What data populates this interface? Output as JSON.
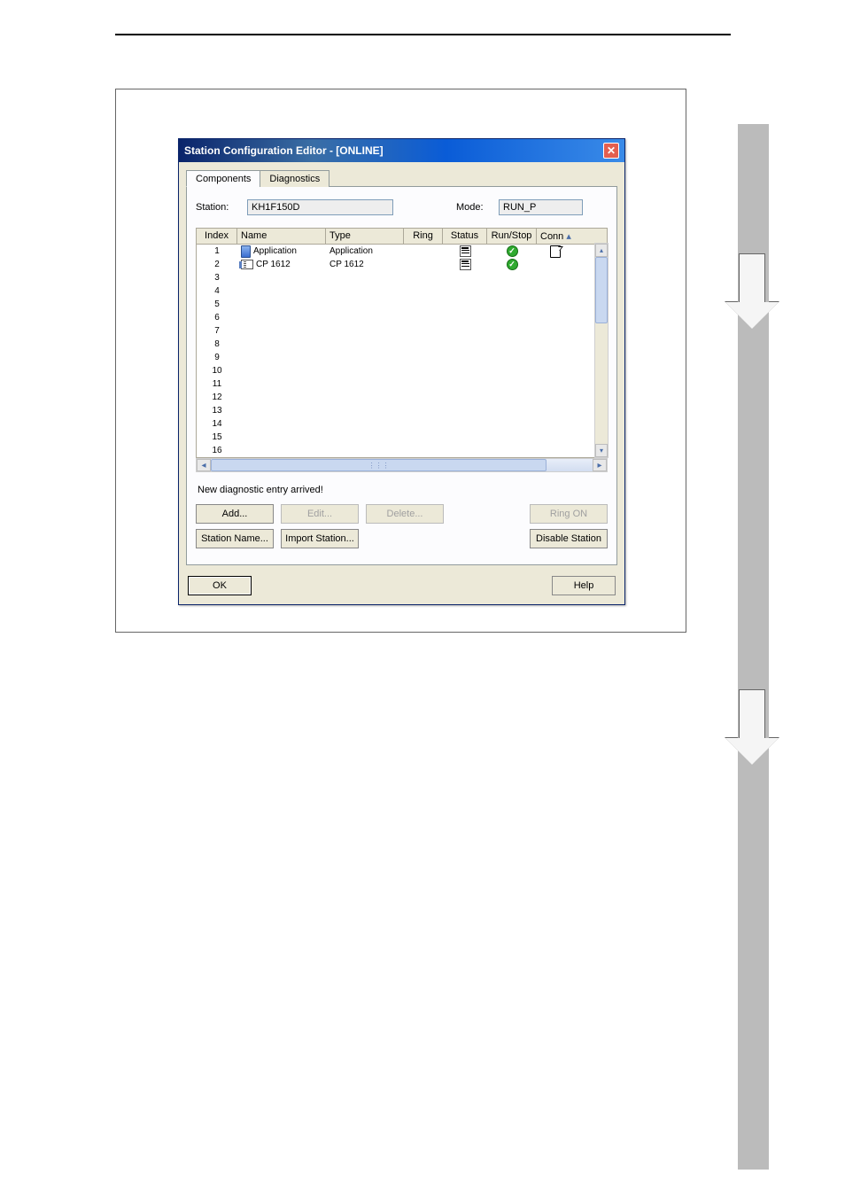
{
  "dialog": {
    "title": "Station Configuration Editor - [ONLINE]",
    "tabs": {
      "components": "Components",
      "diagnostics": "Diagnostics"
    },
    "fields": {
      "station_label": "Station:",
      "station_value": "KH1F150D",
      "mode_label": "Mode:",
      "mode_value": "RUN_P"
    },
    "columns": {
      "index": "Index",
      "name": "Name",
      "type": "Type",
      "ring": "Ring",
      "status": "Status",
      "runstop": "Run/Stop",
      "conn": "Conn"
    },
    "rows": [
      {
        "index": "1",
        "name": "Application",
        "type": "Application",
        "has_app_icon": true,
        "has_status": true,
        "has_run": true,
        "has_conn": true
      },
      {
        "index": "2",
        "name": "CP 1612",
        "type": "CP 1612",
        "has_card_icon": true,
        "has_status": true,
        "has_run": true
      },
      {
        "index": "3"
      },
      {
        "index": "4"
      },
      {
        "index": "5"
      },
      {
        "index": "6"
      },
      {
        "index": "7"
      },
      {
        "index": "8"
      },
      {
        "index": "9"
      },
      {
        "index": "10"
      },
      {
        "index": "11"
      },
      {
        "index": "12"
      },
      {
        "index": "13"
      },
      {
        "index": "14"
      },
      {
        "index": "15"
      },
      {
        "index": "16"
      }
    ],
    "status_message": "New diagnostic entry arrived!",
    "buttons": {
      "add": "Add...",
      "edit": "Edit...",
      "delete": "Delete...",
      "ring_on": "Ring ON",
      "station_name": "Station Name...",
      "import_station": "Import Station...",
      "disable_station": "Disable Station",
      "ok": "OK",
      "help": "Help"
    }
  }
}
